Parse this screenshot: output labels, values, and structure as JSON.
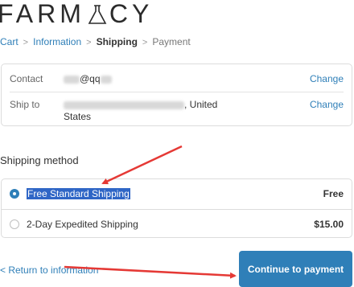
{
  "brand": {
    "logo_before": "FARM",
    "logo_after": "CY"
  },
  "breadcrumb": {
    "items": [
      "Cart",
      "Information",
      "Shipping",
      "Payment"
    ],
    "separator": ">"
  },
  "review": {
    "contact_label": "Contact",
    "contact_value": "@qq",
    "ship_to_label": "Ship to",
    "ship_to_value_line1": ", United",
    "ship_to_value_line2": "States",
    "change_label": "Change"
  },
  "shipping": {
    "title": "Shipping method",
    "methods": [
      {
        "name": "Free Standard Shipping",
        "price": "Free",
        "selected": true
      },
      {
        "name": "2-Day Expedited Shipping",
        "price": "$15.00",
        "selected": false
      }
    ]
  },
  "footer": {
    "return_label": "< Return to information",
    "continue_label": "Continue to payment"
  },
  "colors": {
    "accent": "#2f7fb8",
    "annotation_arrow": "#e53935",
    "highlight": "#2f66c6"
  }
}
